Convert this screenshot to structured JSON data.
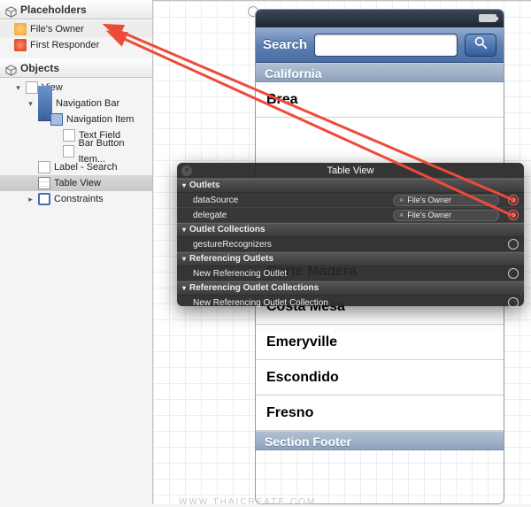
{
  "outline": {
    "placeholders_header": "Placeholders",
    "files_owner": "File's Owner",
    "first_responder": "First Responder",
    "objects_header": "Objects",
    "view": "View",
    "navigation_bar": "Navigation Bar",
    "navigation_item": "Navigation Item",
    "text_field": "Text Field",
    "bar_button_item": "Bar Button Item...",
    "label_search": "Label - Search",
    "table_view": "Table View",
    "constraints": "Constraints"
  },
  "phone": {
    "search_label": "Search",
    "search_placeholder": "",
    "section_header": "California",
    "cells": {
      "c0": "Brea",
      "c1": "Corte Madera",
      "c2": "Costa Mesa",
      "c3": "Emeryville",
      "c4": "Escondido",
      "c5": "Fresno"
    },
    "section_footer": "Section Footer"
  },
  "hud": {
    "title": "Table View",
    "outlets_header": "Outlets",
    "dataSource_label": "dataSource",
    "dataSource_dest": "File's Owner",
    "delegate_label": "delegate",
    "delegate_dest": "File's Owner",
    "outlet_collections_header": "Outlet Collections",
    "gesture_label": "gestureRecognizers",
    "referencing_outlets_header": "Referencing Outlets",
    "new_ref_outlet": "New Referencing Outlet",
    "referencing_outlet_collections_header": "Referencing Outlet Collections",
    "new_ref_outlet_collection": "New Referencing Outlet Collection"
  },
  "watermark": "WWW.THAICREATE.COM"
}
